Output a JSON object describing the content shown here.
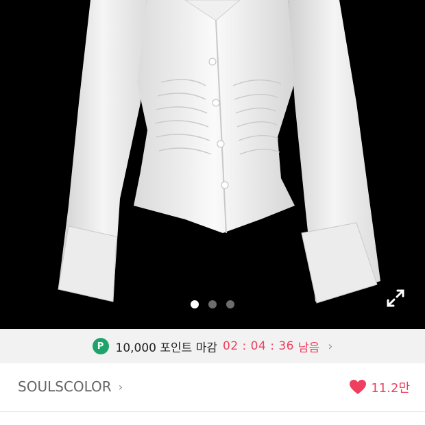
{
  "gallery": {
    "image_alt": "white ruched button-up blouse",
    "total_images": 3,
    "active_index": 0
  },
  "points_bar": {
    "badge": "P",
    "text": "10,000 포인트 마감",
    "timer": "02 : 04 : 36",
    "suffix": "남음",
    "chevron": "›"
  },
  "seller": {
    "name": "SOULSCOLOR",
    "chevron": "›"
  },
  "like": {
    "count": "11.2만",
    "color": "#ef3f5e"
  },
  "icons": {
    "expand": "expand-icon",
    "heart": "heart-icon"
  }
}
